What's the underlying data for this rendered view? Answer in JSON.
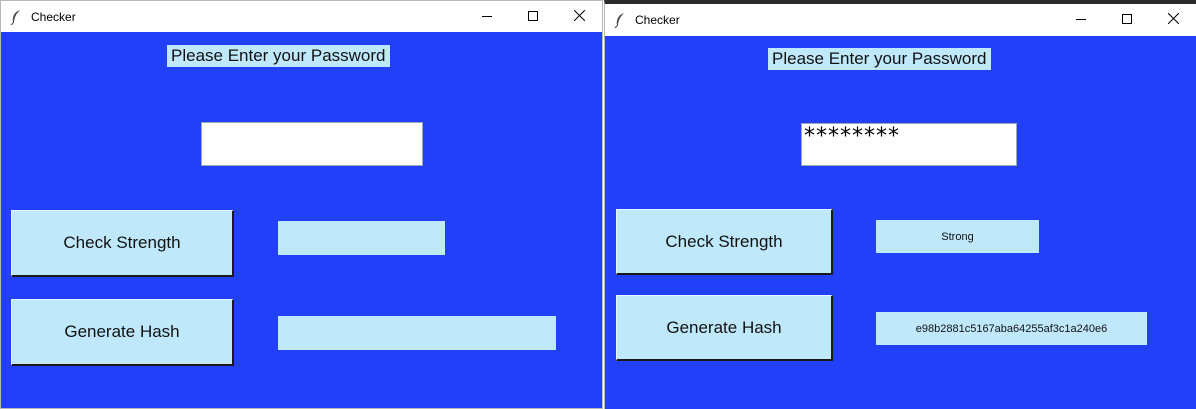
{
  "left_window": {
    "title": "Checker",
    "prompt": "Please Enter your Password",
    "password_value": "",
    "check_strength_label": "Check Strength",
    "generate_hash_label": "Generate Hash",
    "strength_result": "",
    "hash_result": ""
  },
  "right_window": {
    "title": "Checker",
    "prompt": "Please Enter your Password",
    "password_value": "********",
    "check_strength_label": "Check Strength",
    "generate_hash_label": "Generate Hash",
    "strength_result": "Strong",
    "hash_result": "e98b2881c5167aba64255af3c1a240e6"
  },
  "colors": {
    "client_background": "#2240f7",
    "widget_background": "#bfe9fb",
    "entry_background": "#ffffff"
  },
  "icons": {
    "app_icon": "feather-icon",
    "minimize": "minimize-icon",
    "maximize": "maximize-icon",
    "close": "close-icon"
  }
}
